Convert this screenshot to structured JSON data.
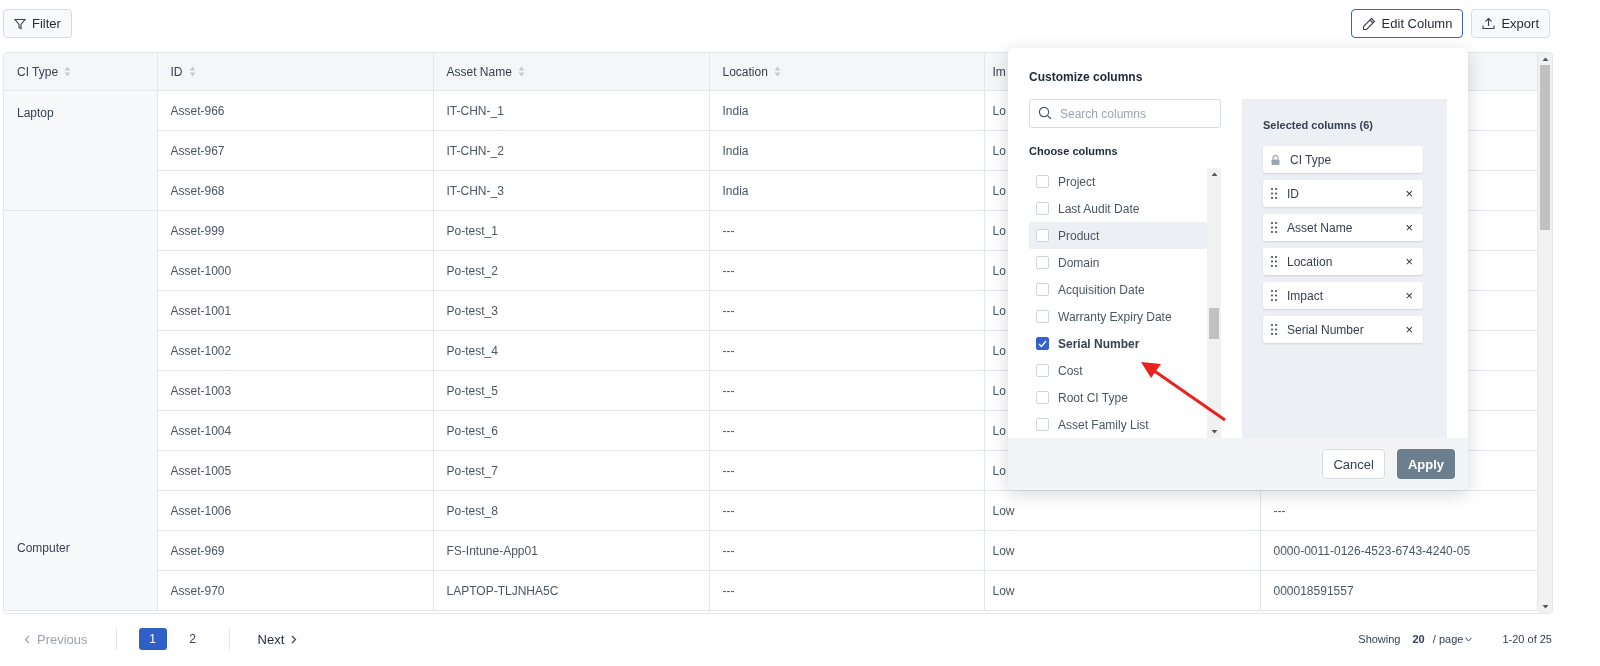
{
  "toolbar": {
    "filter_button": "Filter",
    "edit_column_button": "Edit Column",
    "export_button": "Export"
  },
  "table": {
    "columns": [
      {
        "label": "CI Type",
        "sortable": true
      },
      {
        "label": "ID",
        "sortable": true
      },
      {
        "label": "Asset Name",
        "sortable": true
      },
      {
        "label": "Location",
        "sortable": true
      },
      {
        "label": "Im",
        "sortable": false
      }
    ],
    "groups": [
      {
        "ci_type": "Laptop",
        "rows": [
          {
            "id": "Asset-966",
            "asset_name": "IT-CHN-_1",
            "location": "India",
            "impact": "Lo"
          },
          {
            "id": "Asset-967",
            "asset_name": "IT-CHN-_2",
            "location": "India",
            "impact": "Lo"
          },
          {
            "id": "Asset-968",
            "asset_name": "IT-CHN-_3",
            "location": "India",
            "impact": "Lo"
          }
        ]
      },
      {
        "ci_type": "Computer",
        "rows": [
          {
            "id": "Asset-999",
            "asset_name": "Po-test_1",
            "location": "---",
            "impact": "Lo"
          },
          {
            "id": "Asset-1000",
            "asset_name": "Po-test_2",
            "location": "---",
            "impact": "Lo"
          },
          {
            "id": "Asset-1001",
            "asset_name": "Po-test_3",
            "location": "---",
            "impact": "Lo"
          },
          {
            "id": "Asset-1002",
            "asset_name": "Po-test_4",
            "location": "---",
            "impact": "Lo"
          },
          {
            "id": "Asset-1003",
            "asset_name": "Po-test_5",
            "location": "---",
            "impact": "Lo"
          },
          {
            "id": "Asset-1004",
            "asset_name": "Po-test_6",
            "location": "---",
            "impact": "Lo"
          },
          {
            "id": "Asset-1005",
            "asset_name": "Po-test_7",
            "location": "---",
            "impact": "Lo"
          },
          {
            "id": "Asset-1006",
            "asset_name": "Po-test_8",
            "location": "---",
            "impact": "Low",
            "serial_number": "---"
          },
          {
            "id": "Asset-969",
            "asset_name": "FS-Intune-App01",
            "location": "---",
            "impact": "Low",
            "serial_number": "0000-0011-0126-4523-6743-4240-05"
          },
          {
            "id": "Asset-970",
            "asset_name": "LAPTOP-TLJNHA5C",
            "location": "---",
            "impact": "Low",
            "serial_number": "000018591557"
          }
        ]
      }
    ]
  },
  "customize_columns": {
    "title": "Customize columns",
    "search": {
      "placeholder": "Search columns"
    },
    "choose_label": "Choose columns",
    "options": [
      {
        "label": "Project",
        "checked": false,
        "highlighted": false
      },
      {
        "label": "Last Audit Date",
        "checked": false,
        "highlighted": false
      },
      {
        "label": "Product",
        "checked": false,
        "highlighted": true
      },
      {
        "label": "Domain",
        "checked": false,
        "highlighted": false
      },
      {
        "label": "Acquisition Date",
        "checked": false,
        "highlighted": false
      },
      {
        "label": "Warranty Expiry Date",
        "checked": false,
        "highlighted": false
      },
      {
        "label": "Serial Number",
        "checked": true,
        "highlighted": false
      },
      {
        "label": "Cost",
        "checked": false,
        "highlighted": false
      },
      {
        "label": "Root CI Type",
        "checked": false,
        "highlighted": false
      },
      {
        "label": "Asset Family List",
        "checked": false,
        "highlighted": false
      }
    ],
    "selected_title": "Selected columns (6)",
    "selected": [
      {
        "label": "CI Type",
        "kind": "locked"
      },
      {
        "label": "ID",
        "kind": "removable"
      },
      {
        "label": "Asset Name",
        "kind": "removable"
      },
      {
        "label": "Location",
        "kind": "removable"
      },
      {
        "label": "Impact",
        "kind": "removable"
      },
      {
        "label": "Serial Number",
        "kind": "removable"
      }
    ],
    "remove_glyph": "×",
    "cancel_button": "Cancel",
    "apply_button": "Apply"
  },
  "pagination": {
    "previous": "Previous",
    "pages": [
      {
        "label": "1",
        "selected": true
      },
      {
        "label": "2",
        "selected": false
      }
    ],
    "next": "Next",
    "showing_label": "Showing",
    "page_size": "20",
    "per_page": "/  page",
    "range": "1-20 of 25"
  }
}
